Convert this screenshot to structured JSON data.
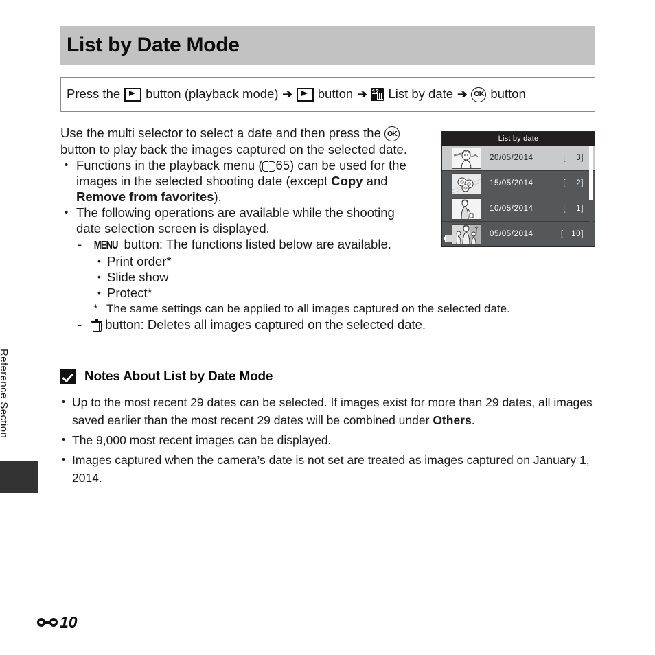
{
  "document": {
    "section_label": "Reference Section",
    "page_number": "10",
    "page_prefix_icon": "reference-section-E-icon"
  },
  "header": {
    "title": "List by Date Mode"
  },
  "procedure": {
    "prefix": "Press the",
    "play_icon": "playback-button-icon",
    "step1": "button (playback mode)",
    "arrow": "➔",
    "play_icon2": "playback-button-icon",
    "step2": "button",
    "calendar_icon": "list-by-date-icon",
    "calendar_icon_number": "12",
    "step3": "List by date",
    "ok_icon": "ok-button-icon",
    "ok_icon_label": "OK",
    "step4": "button"
  },
  "body": {
    "intro_part1": "Use the multi selector to select a date and then press the",
    "intro_ok_icon": "ok-button-icon",
    "intro_ok_label": "OK",
    "intro_part2": "button to play back the images captured on the selected date.",
    "bullet1_part1": "Functions in the playback menu (",
    "bullet1_book_icon": "manual-reference-book-icon",
    "bullet1_page_ref": "65) can be used for the",
    "bullet1_part2": "images in the selected shooting date (except ",
    "bullet1_bold1": "Copy",
    "bullet1_part3": " and",
    "bullet1_bold2": "Remove from favorites",
    "bullet1_part4": ").",
    "bullet2_line1": "The following operations are available while the shooting",
    "bullet2_line2": "date selection screen is displayed.",
    "menu_icon_label": "MENU",
    "menu_line": "button: The functions listed below are available.",
    "menu_options": [
      "Print order*",
      "Slide show",
      "Protect*"
    ],
    "footnote_star": "*",
    "footnote_text": "The same settings can be applied to all images captured on the selected date.",
    "trash_icon": "delete-button-icon",
    "trash_line": "button: Deletes all images captured on the selected date."
  },
  "camera_screen": {
    "title": "List by date",
    "battery_icon": "battery-level-icon",
    "rows": [
      {
        "date": "20/05/2014",
        "count": "[    3]",
        "selected": true,
        "thumb": "portrait-person-thumbnail"
      },
      {
        "date": "15/05/2014",
        "count": "[    2]",
        "selected": false,
        "thumb": "flowers-thumbnail"
      },
      {
        "date": "10/05/2014",
        "count": "[    1]",
        "selected": false,
        "thumb": "standing-person-thumbnail"
      },
      {
        "date": "05/05/2014",
        "count": "[   10]",
        "selected": false,
        "thumb": "family-thumbnail"
      }
    ]
  },
  "notes": {
    "icon": "caution-checkmark-icon",
    "heading": "Notes About List by Date Mode",
    "items": [
      {
        "part1": "Up to the most recent 29 dates can be selected. If images exist for more than 29 dates, all images saved earlier than the most recent 29 dates will be combined under ",
        "bold": "Others",
        "part2": "."
      },
      {
        "part1": "The 9,000 most recent images can be displayed.",
        "bold": "",
        "part2": ""
      },
      {
        "part1": "Images captured when the camera’s date is not set are treated as images captured on January 1, 2014.",
        "bold": "",
        "part2": ""
      }
    ]
  },
  "colors": {
    "title_banner": "#c2c2c2",
    "lcd_background": "#55585a",
    "lcd_titlebar": "#231f20",
    "lcd_selected_row": "#c8cacb",
    "side_tab_block": "#333333"
  }
}
